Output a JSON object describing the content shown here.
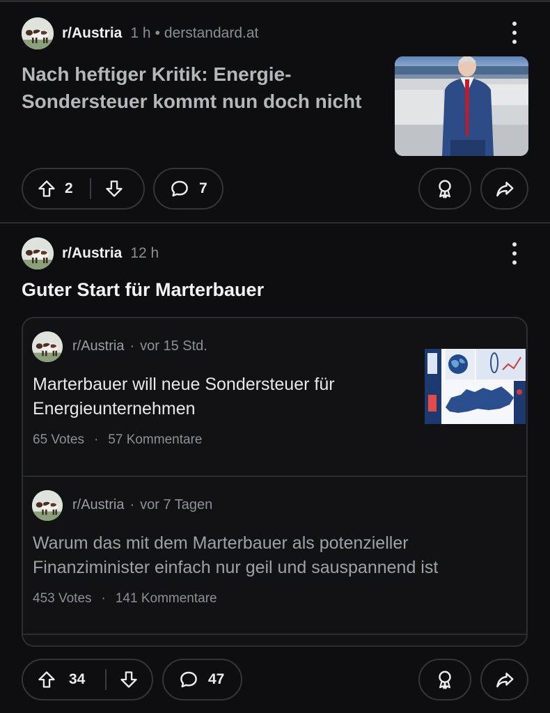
{
  "posts": [
    {
      "subreddit": "r/Austria",
      "time": "1 h",
      "separator": "•",
      "domain": "derstandard.at",
      "title": "Nach heftiger Kritik: Energie-Sondersteuer kommt nun doch nicht",
      "upvotes": "2",
      "comments": "7",
      "thumbnail": "photo-man-in-suit-city-square"
    },
    {
      "subreddit": "r/Austria",
      "time": "12 h",
      "title": "Guter Start für Marterbauer",
      "upvotes": "34",
      "comments": "47",
      "embedded": [
        {
          "subreddit": "r/Austria",
          "separator": "·",
          "time": "vor 15 Std.",
          "title": "Marterbauer will neue Sondersteuer für Energieunternehmen",
          "votes": "65 Votes",
          "comments": "57 Kommentare",
          "thumbnail": "illustration-globe-austria-map"
        },
        {
          "subreddit": "r/Austria",
          "separator": "·",
          "time": "vor 7 Tagen",
          "title": "Warum das mit dem Marterbauer als potenzieller Finanziminister einfach nur geil und sauspannend ist",
          "votes": "453 Votes",
          "comments": "141 Kommentare"
        }
      ]
    }
  ],
  "stat_separator": "·",
  "icons": {
    "upvote": "arrow-up-icon",
    "downvote": "arrow-down-icon",
    "comment": "speech-bubble-icon",
    "award": "award-ribbon-icon",
    "share": "share-arrow-icon",
    "more": "vertical-dots-icon",
    "avatar": "cow-avatar-icon"
  },
  "colors": {
    "background": "#0e0e10",
    "border": "#34353a",
    "muted_text": "#8b8e93",
    "visited_title": "#b6b7ba"
  }
}
